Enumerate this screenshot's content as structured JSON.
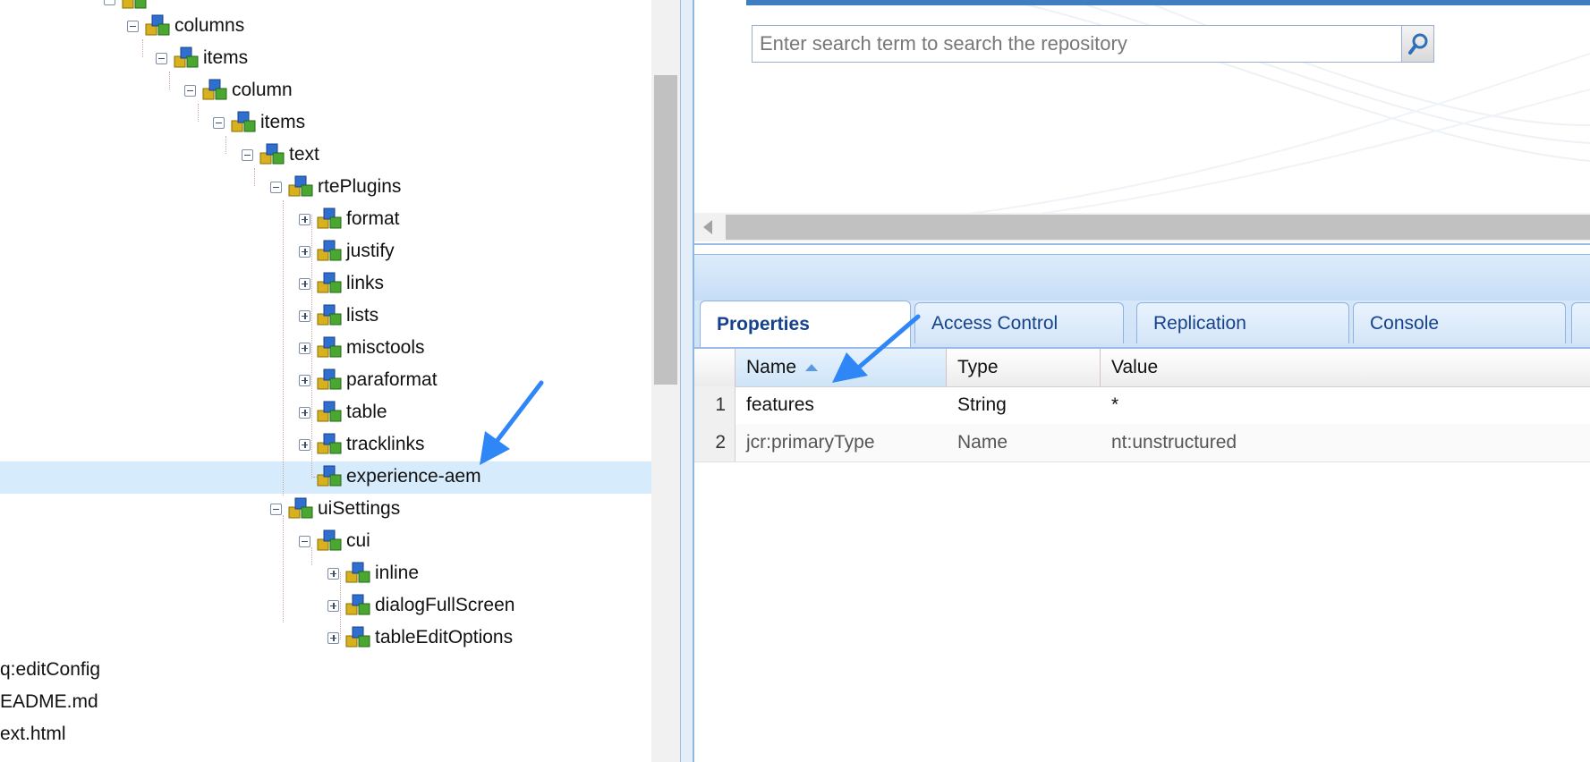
{
  "tree": {
    "nodes": [
      {
        "id": "columns",
        "label": "columns",
        "expander": "minus"
      },
      {
        "id": "items-1",
        "label": "items",
        "expander": "minus"
      },
      {
        "id": "column",
        "label": "column",
        "expander": "minus"
      },
      {
        "id": "items-2",
        "label": "items",
        "expander": "minus"
      },
      {
        "id": "text",
        "label": "text",
        "expander": "minus"
      },
      {
        "id": "rtePlugins",
        "label": "rtePlugins",
        "expander": "minus"
      },
      {
        "id": "format",
        "label": "format",
        "expander": "plus"
      },
      {
        "id": "justify",
        "label": "justify",
        "expander": "plus"
      },
      {
        "id": "links",
        "label": "links",
        "expander": "plus"
      },
      {
        "id": "lists",
        "label": "lists",
        "expander": "plus"
      },
      {
        "id": "misctools",
        "label": "misctools",
        "expander": "plus"
      },
      {
        "id": "paraformat",
        "label": "paraformat",
        "expander": "plus"
      },
      {
        "id": "table",
        "label": "table",
        "expander": "plus"
      },
      {
        "id": "tracklinks",
        "label": "tracklinks",
        "expander": "plus"
      },
      {
        "id": "experience-aem",
        "label": "experience-aem",
        "expander": "none",
        "selected": true
      },
      {
        "id": "uiSettings",
        "label": "uiSettings",
        "expander": "minus"
      },
      {
        "id": "cui",
        "label": "cui",
        "expander": "minus"
      },
      {
        "id": "inline",
        "label": "inline",
        "expander": "plus"
      },
      {
        "id": "dialogFullScreen",
        "label": "dialogFullScreen",
        "expander": "plus"
      },
      {
        "id": "tableEditOptions",
        "label": "tableEditOptions",
        "expander": "plus"
      }
    ],
    "loose_items": [
      "q:editConfig",
      "EADME.md",
      "ext.html"
    ]
  },
  "search": {
    "placeholder": "Enter search term to search the repository",
    "button_icon": "search-icon"
  },
  "tabs": [
    {
      "label": "Properties",
      "active": true
    },
    {
      "label": "Access Control",
      "active": false
    },
    {
      "label": "Replication",
      "active": false
    },
    {
      "label": "Console",
      "active": false
    }
  ],
  "grid": {
    "columns": [
      {
        "label": "Name",
        "sorted": "asc"
      },
      {
        "label": "Type"
      },
      {
        "label": "Value"
      }
    ],
    "rows": [
      {
        "num": "1",
        "name": "features",
        "type": "String",
        "value": "*"
      },
      {
        "num": "2",
        "name": "jcr:primaryType",
        "type": "Name",
        "value": "nt:unstructured"
      }
    ]
  },
  "colors": {
    "accent": "#15428b",
    "selection": "#d6ebfb",
    "annotation_arrow": "#2f86f6"
  }
}
